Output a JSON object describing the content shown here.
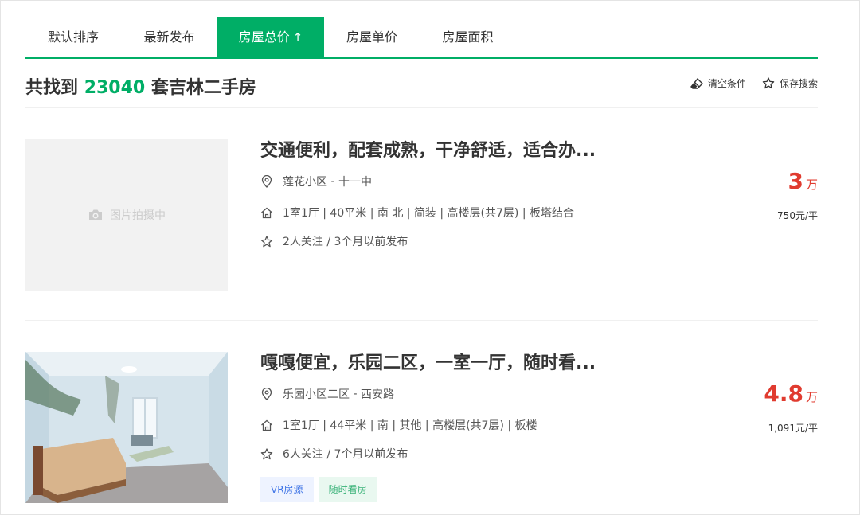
{
  "sort_tabs": [
    {
      "label": "默认排序",
      "active": false
    },
    {
      "label": "最新发布",
      "active": false
    },
    {
      "label": "房屋总价",
      "active": true,
      "arrow": "↑"
    },
    {
      "label": "房屋单价",
      "active": false
    },
    {
      "label": "房屋面积",
      "active": false
    }
  ],
  "result": {
    "prefix": "共找到",
    "count": "23040",
    "suffix": "套吉林二手房"
  },
  "actions": {
    "clear_label": "清空条件",
    "save_label": "保存搜索",
    "clear_icon": "eraser-icon",
    "save_icon": "star-icon"
  },
  "listings": [
    {
      "title": "交通便利，配套成熟，干净舒适，适合办...",
      "image_placeholder": "图片拍摄中",
      "community": "莲花小区",
      "separator": " - ",
      "area": "十一中",
      "details": "1室1厅 | 40平米 | 南 北 | 简装 | 高楼层(共7层) | 板塔结合",
      "follow": "2人关注 / 3个月以前发布",
      "price": "3",
      "price_unit": "万",
      "unit_price": "750元/平"
    },
    {
      "title": "嘎嘎便宜，乐园二区，一室一厅，随时看...",
      "community": "乐园小区二区",
      "separator": " - ",
      "area": "西安路",
      "details": "1室1厅 | 44平米 | 南 | 其他 | 高楼层(共7层) | 板楼",
      "follow": "6人关注 / 7个月以前发布",
      "tags": [
        "VR房源",
        "随时看房"
      ],
      "price": "4.8",
      "price_unit": "万",
      "unit_price": "1,091元/平"
    }
  ],
  "colors": {
    "accent": "#00ae66",
    "price": "#e03b2f",
    "vr_tag": "#3d73e6",
    "kan_tag": "#39b278"
  }
}
